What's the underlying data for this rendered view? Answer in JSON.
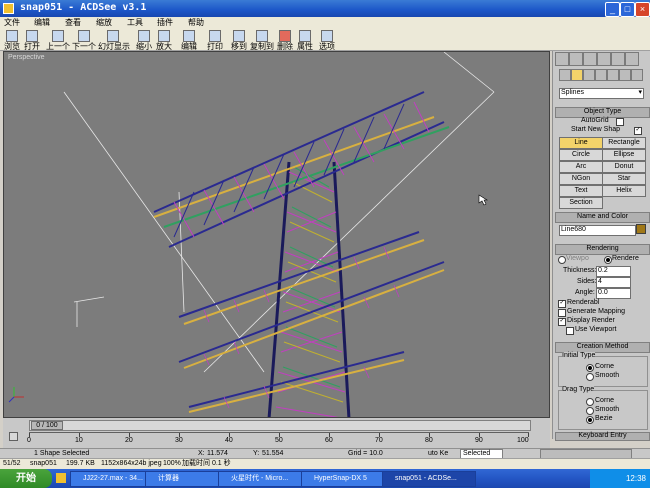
{
  "window": {
    "title": "snap051 - ACDSee v3.1",
    "controls": {
      "minimize": "_",
      "maximize": "□",
      "close": "×"
    }
  },
  "menu": [
    "文件",
    "编辑",
    "查看",
    "缩放",
    "工具",
    "插件",
    "帮助"
  ],
  "toolbar": [
    "浏览",
    "打开",
    "上一个",
    "下一个",
    "幻灯显示",
    "缩小",
    "放大",
    "编辑",
    "打印",
    "移到",
    "复制到",
    "删除",
    "属性",
    "选项"
  ],
  "viewport": {
    "label": "Perspective"
  },
  "panel": {
    "dropdown": "Splines",
    "object_type": {
      "header": "Object Type",
      "autogrid": "AutoGrid",
      "start_new_shape": "Start New Shap",
      "buttons": [
        "Line",
        "Rectangle",
        "Circle",
        "Ellipse",
        "Arc",
        "Donut",
        "NGon",
        "Star",
        "Text",
        "Helix",
        "Section"
      ]
    },
    "name_color": {
      "header": "Name and Color",
      "name": "Line680",
      "color": "#a07818"
    },
    "rendering": {
      "header": "Rendering",
      "viewport": "Viewpo",
      "renderer": "Rendere",
      "thickness_label": "Thickness:",
      "thickness": "0.2",
      "sides_label": "Sides:",
      "sides": "4",
      "angle_label": "Angle:",
      "angle": "0.0",
      "renderable": "Renderabl",
      "gen_mapping": "Generate Mapping",
      "display_render": "Display Render",
      "use_viewport": "Use Viewport"
    },
    "creation": {
      "header": "Creation Method",
      "initial_type": "Initial Type",
      "init_opts": [
        "Corne",
        "Smooth"
      ],
      "drag_type": "Drag Type",
      "drag_opts": [
        "Corne",
        "Smooth",
        "Bezie"
      ]
    },
    "keyboard": "Keyboard Entry"
  },
  "timeline": {
    "frame": "0 / 100",
    "ticks": [
      "0",
      "10",
      "20",
      "30",
      "40",
      "50",
      "60",
      "70",
      "80",
      "90",
      "100"
    ]
  },
  "status": {
    "selection": "1 Shape Selected",
    "x_label": "X:",
    "x": "11.574",
    "y_label": "Y:",
    "y": "51.554",
    "grid": "Grid = 10.0",
    "autokey": "uto Ke",
    "selected": "Selected"
  },
  "status2": {
    "pos": "51/52",
    "file": "snap051",
    "size": "199.7 KB",
    "dims": "1152x864x24b jpeg",
    "zoom": "100%",
    "load": "加载时间 0.1 秒"
  },
  "taskbar": {
    "start": "开始",
    "tasks": [
      "JJ22-27.max - 34...",
      "计算器",
      "火星时代 - Micro...",
      "HyperSnap-DX 5",
      "snap051 - ACDSe..."
    ],
    "clock": "12:38"
  }
}
